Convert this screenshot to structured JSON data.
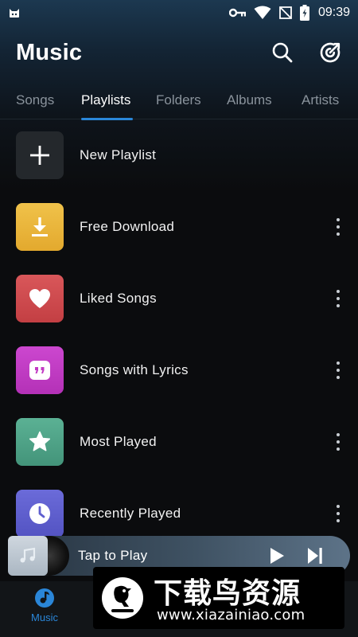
{
  "status_bar": {
    "time": "09:39",
    "icons": [
      "app-notification-icon",
      "key-icon",
      "wifi-icon",
      "no-sim-icon",
      "battery-charging-icon"
    ]
  },
  "header": {
    "title": "Music",
    "actions": [
      "search-icon",
      "equalizer-icon"
    ]
  },
  "tabs": [
    {
      "label": "Songs",
      "active": false
    },
    {
      "label": "Playlists",
      "active": true
    },
    {
      "label": "Folders",
      "active": false
    },
    {
      "label": "Albums",
      "active": false
    },
    {
      "label": "Artists",
      "active": false
    }
  ],
  "playlists": [
    {
      "label": "New Playlist",
      "icon": "plus-icon",
      "color": "#24282c",
      "has_menu": false
    },
    {
      "label": "Free Download",
      "icon": "download-icon",
      "color": "#e8b53a",
      "has_menu": true
    },
    {
      "label": "Liked Songs",
      "icon": "heart-icon",
      "color": "#cf4a4d",
      "has_menu": true
    },
    {
      "label": "Songs with Lyrics",
      "icon": "quote-icon",
      "color": "#c23ac4",
      "has_menu": true
    },
    {
      "label": "Most Played",
      "icon": "star-icon",
      "color": "#4fa388",
      "has_menu": true
    },
    {
      "label": "Recently Played",
      "icon": "clock-icon",
      "color": "#5f5fcf",
      "has_menu": true
    }
  ],
  "mini_player": {
    "title": "Tap to Play",
    "art_icon": "music-note-icon"
  },
  "bottom_nav": {
    "active_label": "Music",
    "accent": "#2a86d8"
  },
  "watermark": {
    "title": "下载鸟资源",
    "url": "www.xiazainiao.com"
  }
}
